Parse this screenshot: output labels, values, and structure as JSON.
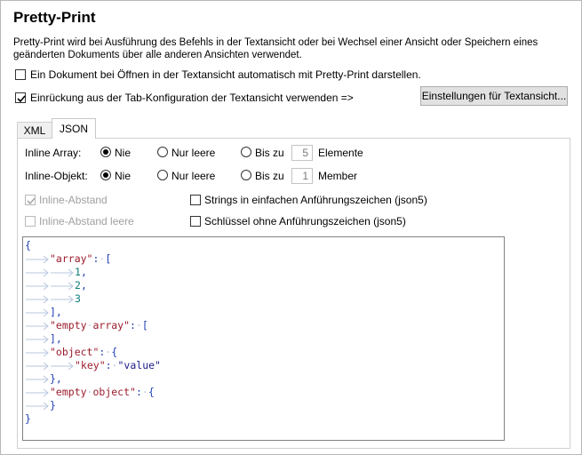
{
  "dialog": {
    "title": "Pretty-Print",
    "description": "Pretty-Print wird bei Ausführung des Befehls in der Textansicht oder bei Wechsel einer Ansicht oder Speichern eines geänderten Dokuments über alle anderen Ansichten verwendet.",
    "option_auto_pretty_print": {
      "label": "Ein Dokument bei Öffnen in der Textansicht automatisch mit Pretty-Print darstellen.",
      "checked": false
    },
    "option_use_tab_config": {
      "label": "Einrückung aus der Tab-Konfiguration der Textansicht verwenden =>",
      "checked": true
    },
    "settings_button": "Einstellungen für Textansicht..."
  },
  "tabs": [
    {
      "label": "XML",
      "active": false
    },
    {
      "label": "JSON",
      "active": true
    }
  ],
  "json": {
    "inline_array": {
      "label": "Inline Array:",
      "options": [
        "Nie",
        "Nur leere",
        "Bis zu"
      ],
      "selected": "Nie",
      "value": "5",
      "unit": "Elemente"
    },
    "inline_object": {
      "label": "Inline-Objekt:",
      "options": [
        "Nie",
        "Nur leere",
        "Bis zu"
      ],
      "selected": "Nie",
      "value": "1",
      "unit": "Member"
    },
    "inline_spacing": {
      "label": "Inline-Abstand",
      "checked": true,
      "disabled": true
    },
    "inline_spacing_empty": {
      "label": "Inline-Abstand leere",
      "checked": false,
      "disabled": true
    },
    "single_quotes": {
      "label": "Strings in einfachen Anführungszeichen (json5)",
      "checked": false
    },
    "unquoted_keys": {
      "label": "Schlüssel ohne Anführungszeichen (json5)",
      "checked": false
    }
  },
  "preview": {
    "lines": [
      {
        "indent": 0,
        "tokens": [
          [
            "p",
            "{"
          ]
        ]
      },
      {
        "indent": 1,
        "tokens": [
          [
            "k",
            "\"array\""
          ],
          [
            "p",
            ":"
          ],
          [
            "dot",
            "·"
          ],
          [
            "p",
            "["
          ]
        ]
      },
      {
        "indent": 2,
        "tokens": [
          [
            "n",
            "1"
          ],
          [
            "p",
            ","
          ]
        ]
      },
      {
        "indent": 2,
        "tokens": [
          [
            "n",
            "2"
          ],
          [
            "p",
            ","
          ]
        ]
      },
      {
        "indent": 2,
        "tokens": [
          [
            "n",
            "3"
          ]
        ]
      },
      {
        "indent": 1,
        "tokens": [
          [
            "p",
            "],"
          ]
        ]
      },
      {
        "indent": 1,
        "tokens": [
          [
            "k",
            "\"empty"
          ],
          [
            "dot",
            "·"
          ],
          [
            "k",
            "array\""
          ],
          [
            "p",
            ":"
          ],
          [
            "dot",
            "·"
          ],
          [
            "p",
            "["
          ]
        ]
      },
      {
        "indent": 1,
        "tokens": [
          [
            "p",
            "],"
          ]
        ]
      },
      {
        "indent": 1,
        "tokens": [
          [
            "k",
            "\"object\""
          ],
          [
            "p",
            ":"
          ],
          [
            "dot",
            "·"
          ],
          [
            "p",
            "{"
          ]
        ]
      },
      {
        "indent": 2,
        "tokens": [
          [
            "k",
            "\"key\""
          ],
          [
            "p",
            ":"
          ],
          [
            "dot",
            "·"
          ],
          [
            "s",
            "\"value\""
          ]
        ]
      },
      {
        "indent": 1,
        "tokens": [
          [
            "p",
            "},"
          ]
        ]
      },
      {
        "indent": 1,
        "tokens": [
          [
            "k",
            "\"empty"
          ],
          [
            "dot",
            "·"
          ],
          [
            "k",
            "object\""
          ],
          [
            "p",
            ":"
          ],
          [
            "dot",
            "·"
          ],
          [
            "p",
            "{"
          ]
        ]
      },
      {
        "indent": 1,
        "tokens": [
          [
            "p",
            "}"
          ]
        ]
      },
      {
        "indent": 0,
        "tokens": [
          [
            "p",
            "}"
          ]
        ]
      }
    ]
  },
  "colors": {
    "key": "#9b1c2c",
    "string": "#1a1a8a",
    "number": "#0e7a7a",
    "punct": "#1e3fb3",
    "whitespace": "#b8c7df"
  }
}
